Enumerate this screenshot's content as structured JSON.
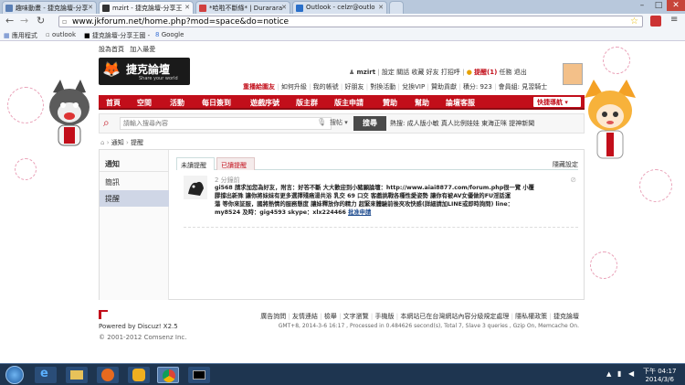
{
  "browser": {
    "tabs": [
      {
        "label": "趣味動畫 - 捷克論壇-分享",
        "color": "#5a7fb5"
      },
      {
        "label": "mzirt - 捷克論壇-分享王",
        "color": "#333333"
      },
      {
        "label": "*哈啦不斷條* | Durarara",
        "color": "#d04040"
      },
      {
        "label": "Outlook - celzr@outlo",
        "color": "#2a6fc9"
      }
    ],
    "url": "www.jkforum.net/home.php?mod=space&do=notice",
    "bookmarks": [
      "應用程式",
      "outlook",
      "捷克論壇-分享王國 -",
      "Google"
    ],
    "window_controls": [
      "–",
      "□",
      "✕"
    ]
  },
  "site": {
    "top_links": [
      "設為首頁",
      "加入最愛"
    ],
    "logo_text": "捷克論壇",
    "logo_sub": "Share your world",
    "user": {
      "name": "mzirt",
      "links": [
        "設定",
        "關話",
        "收藏",
        "好友",
        "打招呼"
      ],
      "notice": "提醒(1)",
      "extra": [
        "任務",
        "退出"
      ]
    },
    "sub_links": [
      "重播給圍友",
      "如何升級",
      "我的帳號",
      "好朋友",
      "對換活動",
      "兌換VIP",
      "贊助貢獻",
      "積分: 923",
      "會員組: 見習騎士"
    ],
    "nav": [
      "首頁",
      "空間",
      "活動",
      "每日簽到",
      "遊戲序號",
      "版主群",
      "版主申請",
      "贊助",
      "幫助",
      "論壇客服"
    ],
    "quick_nav": "快捷導航",
    "search": {
      "placeholder": "請輸入搜尋內容",
      "type": "搜帖",
      "button": "搜尋",
      "hot_label": "熱搜:",
      "hot": [
        "成人版小敏",
        "真人比例娃娃",
        "東海正咪",
        "提神新聞"
      ]
    },
    "breadcrumb": [
      "通知",
      "提醒"
    ],
    "sidebar": {
      "title": "通知",
      "items": [
        "簡訊",
        "提醒"
      ]
    },
    "tabs": [
      "未讀提醒",
      "已讀提醒"
    ],
    "settings_link": "隱藏設定",
    "notice_item": {
      "time": "2 分鐘前",
      "lines": [
        "gi568 請求加您為好友，附言：好答不斷 大大歡迎到小豬願論壇：http://www.aiai8877.com/forum.php很一覽 小覆",
        "膠撐出新殊 讓你將妹妹有更多選擇殘癌湯共浴 乳交 69 口交 客戲挑戰各種性愛姿勢 讓你有被AV女優做的FU淫話運",
        "蕩 等你來証服，國將熱情的服務態度 讓妹釋放你的精力 超緊來體驗前後夾攻快感(詳細請加LINE或即時詢問) line：",
        "my8524 及時：gig4593 skype：xlx224466"
      ],
      "action": "批准申請"
    },
    "footer": {
      "powered": "Powered by Discuz! X2.5",
      "copyright": "© 2001-2012 Comsenz Inc.",
      "links": [
        "廣告詢問",
        "友情連結",
        "檢舉",
        "文字瀏覽",
        "手機版",
        "本網站已在台灣網站內容分級規定處理",
        "隱私權政策",
        "捷克論壇"
      ],
      "stats": "GMT+8, 2014-3-6 16:17 , Processed in 0.484626 second(s), Total 7, Slave 3 queries , Gzip On, Memcache On."
    }
  },
  "taskbar": {
    "clock_time": "下午 04:17",
    "clock_date": "2014/3/6"
  },
  "colors": {
    "accent": "#c20e1a",
    "link": "#1c4a8e",
    "taskbar": "#1e3550"
  }
}
